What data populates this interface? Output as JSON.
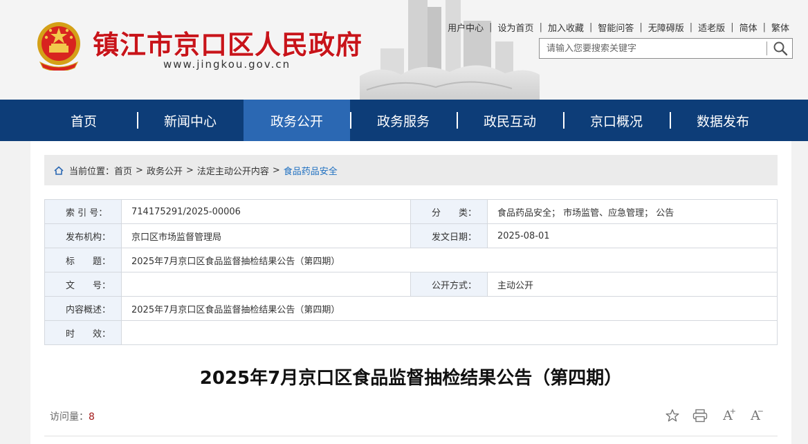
{
  "header": {
    "site_title": "镇江市京口区人民政府",
    "domain": "www.jingkou.gov.cn",
    "top_links": [
      "用户中心",
      "设为首页",
      "加入收藏",
      "智能问答",
      "无障碍版",
      "适老版",
      "简体",
      "繁体"
    ],
    "search": {
      "placeholder": "请输入您要搜索关键字",
      "icon": "search-icon"
    }
  },
  "nav": {
    "items": [
      "首页",
      "新闻中心",
      "政务公开",
      "政务服务",
      "政民互动",
      "京口概况",
      "数据发布"
    ],
    "active": "政务公开"
  },
  "breadcrumb": {
    "label": "当前位置：",
    "items": [
      "首页",
      "政务公开",
      "法定主动公开内容",
      "食品药品安全"
    ]
  },
  "meta": {
    "index_label": "索 引 号：",
    "index_value": "714175291/2025-00006",
    "category_label": "分　　类：",
    "category_value": "食品药品安全； 市场监管、应急管理； 公告",
    "issuer_label": "发布机构：",
    "issuer_value": "京口区市场监督管理局",
    "date_label": "发文日期：",
    "date_value": "2025-08-01",
    "title_label": "标　　题：",
    "title_value": "2025年7月京口区食品监督抽检结果公告（第四期）",
    "docno_label": "文　　号：",
    "docno_value": "",
    "mode_label": "公开方式：",
    "mode_value": "主动公开",
    "summary_label": "内容概述：",
    "summary_value": "2025年7月京口区食品监督抽检结果公告（第四期）",
    "validity_label": "时　　效：",
    "validity_value": ""
  },
  "article": {
    "title": "2025年7月京口区食品监督抽检结果公告（第四期）",
    "visits_label": "访问量：",
    "visits_count": "8",
    "tools": [
      "star-icon",
      "print-icon",
      "font-increase-icon",
      "font-decrease-icon"
    ]
  },
  "colors": {
    "nav_bg": "#0d3d78",
    "nav_active": "#2b68b3",
    "title_red": "#c8141a",
    "link_blue": "#1e6fc0"
  }
}
